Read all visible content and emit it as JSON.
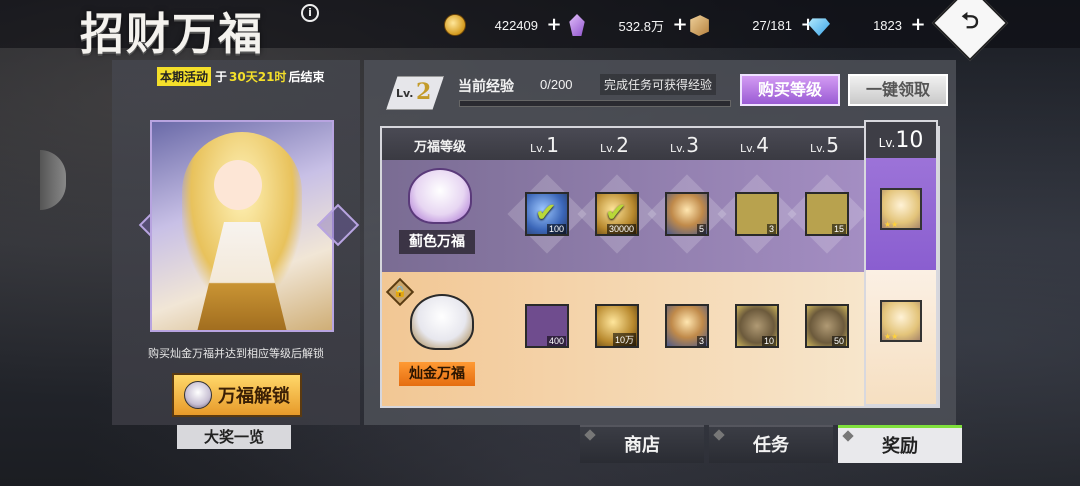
{
  "header": {
    "title": "招财万福",
    "resources": [
      {
        "icon": "coin-icon",
        "value": "422409"
      },
      {
        "icon": "crystal-icon",
        "value": "532.8万"
      },
      {
        "icon": "box-icon",
        "value": "27/181"
      },
      {
        "icon": "gem-icon",
        "value": "1823"
      }
    ],
    "plus": "+",
    "back_glyph": "⮌"
  },
  "event": {
    "tag": "本期活动",
    "prefix": "于",
    "time": "30天21时",
    "suffix": "后结束"
  },
  "left": {
    "unlock_note": "购买灿金万福并达到相应等级后解锁",
    "unlock_button": "万福解锁",
    "grand_prize_button": "大奖一览"
  },
  "progress": {
    "level_prefix": "Lv.",
    "level": "2",
    "exp_label": "当前经验",
    "exp_value": "0/200",
    "exp_fraction": 0,
    "task_hint": "完成任务可获得经验",
    "buy_button": "购买等级",
    "claim_button": "一键领取"
  },
  "grid": {
    "tier_column_title": "万福等级",
    "level_prefix": "Lv.",
    "levels": [
      "1",
      "2",
      "3",
      "4",
      "5"
    ],
    "final_level": "10",
    "tiers": [
      {
        "name": "蓟色万福",
        "rewards": [
          {
            "item": "blue-ore",
            "qty": "100",
            "claimed": true
          },
          {
            "item": "gold-ore",
            "qty": "30000",
            "claimed": true
          },
          {
            "item": "bottle",
            "qty": "5",
            "claimed": false
          },
          {
            "item": "shell",
            "qty": "3",
            "claimed": false
          },
          {
            "item": "shell",
            "qty": "15",
            "claimed": false
          }
        ]
      },
      {
        "name": "灿金万福",
        "locked": true,
        "rewards": [
          {
            "item": "blue-ore",
            "qty": "400"
          },
          {
            "item": "gold-ore",
            "qty": "10万"
          },
          {
            "item": "bottle",
            "qty": "3"
          },
          {
            "item": "shell",
            "qty": "10"
          },
          {
            "item": "shell",
            "qty": "50"
          }
        ]
      }
    ],
    "check_glyph": "✔",
    "lock_glyph": "🔒",
    "stars": "★★"
  },
  "nav": {
    "shop": "商店",
    "task": "任务",
    "reward": "奖励"
  }
}
